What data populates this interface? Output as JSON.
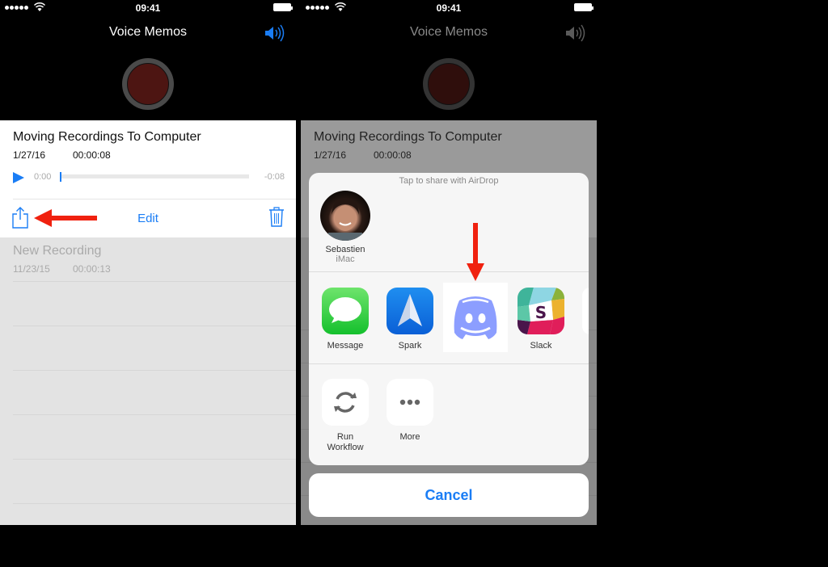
{
  "status_bar": {
    "time": "09:41"
  },
  "app": {
    "title": "Voice Memos"
  },
  "recordings": [
    {
      "title": "Moving Recordings To Computer",
      "date": "1/27/16",
      "duration": "00:00:08"
    },
    {
      "title": "New Recording",
      "date": "11/23/15",
      "duration": "00:00:13"
    }
  ],
  "player": {
    "elapsed": "0:00",
    "remaining": "-0:08",
    "progress": 0
  },
  "toolbar": {
    "edit_label": "Edit"
  },
  "share_sheet": {
    "airdrop_hint": "Tap to share with AirDrop",
    "contact": {
      "name": "Sebastien",
      "device": "iMac"
    },
    "apps": [
      {
        "label": "Message",
        "icon": "messages-icon"
      },
      {
        "label": "Spark",
        "icon": "spark-icon"
      },
      {
        "label": "",
        "icon": "discord-icon"
      },
      {
        "label": "Slack",
        "icon": "slack-icon"
      }
    ],
    "actions": [
      {
        "label": "Run Workflow",
        "icon": "refresh-icon"
      },
      {
        "label": "More",
        "icon": "more-icon"
      }
    ],
    "cancel_label": "Cancel"
  },
  "colors": {
    "accent": "#1a7df5",
    "annotation": "#f0210f",
    "record": "#4d1512",
    "discord": "#8c9eff"
  }
}
